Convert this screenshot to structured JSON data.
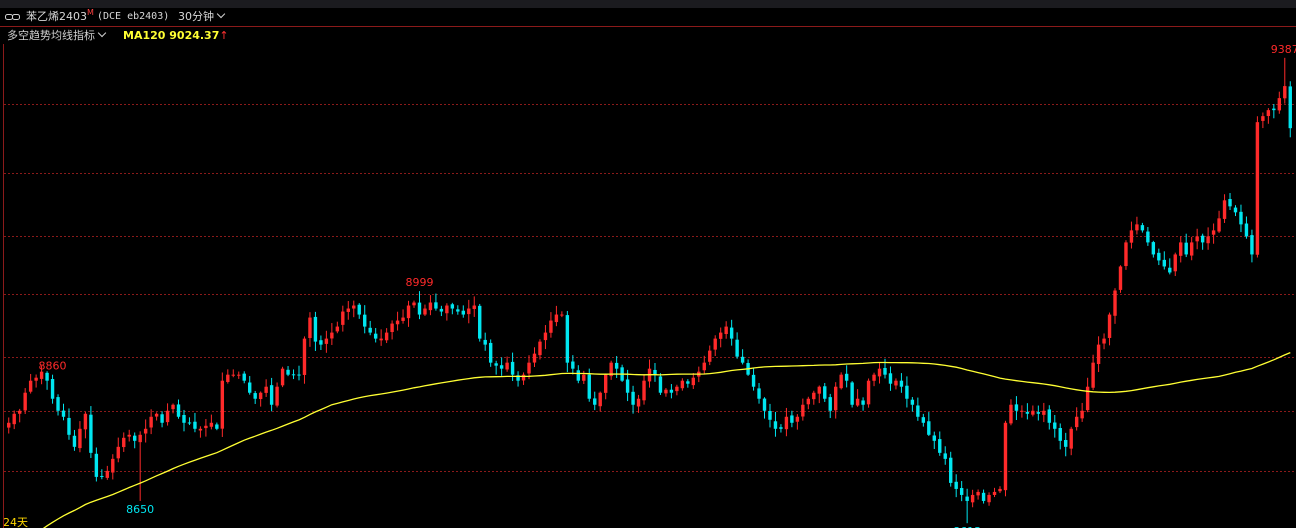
{
  "header": {
    "instrument_name": "苯乙烯2403",
    "superscript": "M",
    "code": "(DCE eb2403)",
    "period": "30分钟",
    "link_icon": "link-icon",
    "dropdown_icon": "chevron-down-icon"
  },
  "indicator": {
    "name": "多空趋势均线指标",
    "ma_label": "MA120",
    "ma_value": "9024.37",
    "ma_arrow": "↑",
    "dropdown_icon": "chevron-down-icon"
  },
  "footer": {
    "day_label": "24天"
  },
  "colors": {
    "up": "#ff2a2a",
    "down": "#00e6f0",
    "ma": "#ffff33",
    "grid": "#8b1a1a",
    "signal": "#ffd700"
  },
  "chart_data": {
    "type": "candlestick",
    "ylim": [
      8605,
      9410
    ],
    "visible_gridlines": [
      9310,
      9195,
      9090,
      8995,
      8890,
      8800,
      8700
    ],
    "close": [
      8780,
      8795,
      8800,
      8830,
      8850,
      8855,
      8865,
      8850,
      8820,
      8800,
      8790,
      8760,
      8740,
      8770,
      8795,
      8730,
      8690,
      8690,
      8700,
      8720,
      8740,
      8755,
      8760,
      8750,
      8760,
      8770,
      8790,
      8795,
      8780,
      8800,
      8810,
      8790,
      8780,
      8780,
      8770,
      8770,
      8775,
      8780,
      8770,
      8850,
      8860,
      8860,
      8860,
      8850,
      8830,
      8820,
      8830,
      8840,
      8810,
      8840,
      8870,
      8860,
      8860,
      8860,
      8920,
      8955,
      8915,
      8910,
      8920,
      8930,
      8940,
      8965,
      8970,
      8975,
      8960,
      8940,
      8930,
      8920,
      8920,
      8930,
      8945,
      8950,
      8955,
      8975,
      8980,
      8960,
      8970,
      8980,
      8970,
      8965,
      8975,
      8970,
      8965,
      8960,
      8970,
      8975,
      8920,
      8910,
      8880,
      8875,
      8870,
      8880,
      8860,
      8850,
      8860,
      8880,
      8895,
      8915,
      8930,
      8950,
      8960,
      8960,
      8880,
      8870,
      8850,
      8860,
      8820,
      8810,
      8830,
      8860,
      8880,
      8870,
      8850,
      8830,
      8810,
      8820,
      8850,
      8870,
      8860,
      8830,
      8835,
      8830,
      8840,
      8850,
      8845,
      8855,
      8865,
      8880,
      8900,
      8920,
      8930,
      8940,
      8920,
      8890,
      8880,
      8860,
      8840,
      8820,
      8800,
      8785,
      8770,
      8770,
      8790,
      8780,
      8790,
      8810,
      8820,
      8830,
      8840,
      8820,
      8800,
      8840,
      8860,
      8850,
      8810,
      8820,
      8810,
      8850,
      8860,
      8870,
      8860,
      8845,
      8850,
      8840,
      8820,
      8810,
      8790,
      8780,
      8760,
      8750,
      8730,
      8720,
      8680,
      8670,
      8660,
      8650,
      8660,
      8665,
      8650,
      8660,
      8665,
      8670,
      8780,
      8810,
      8800,
      8800,
      8795,
      8800,
      8795,
      8800,
      8780,
      8770,
      8750,
      8740,
      8770,
      8790,
      8800,
      8840,
      8880,
      8910,
      8920,
      8960,
      9000,
      9040,
      9080,
      9100,
      9110,
      9100,
      9080,
      9060,
      9050,
      9040,
      9030,
      9060,
      9080,
      9060,
      9080,
      9090,
      9080,
      9090,
      9100,
      9120,
      9150,
      9140,
      9130,
      9110,
      9090,
      9060,
      9280,
      9290,
      9300,
      9300,
      9320,
      9340,
      9270
    ]
  }
}
